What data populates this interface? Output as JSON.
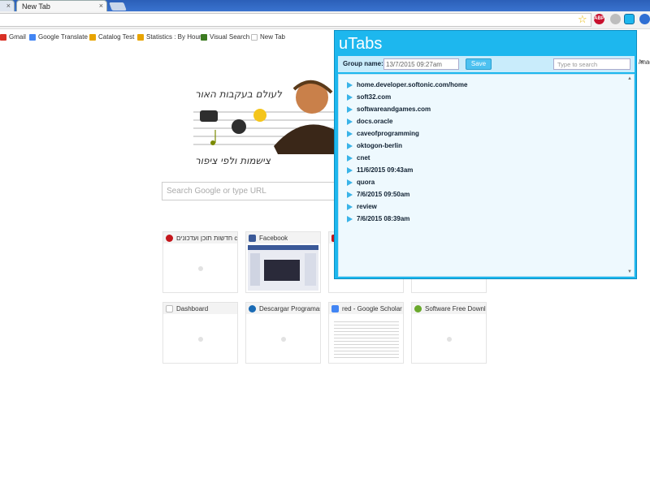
{
  "tabs": [
    {
      "label": "",
      "close": "×"
    },
    {
      "label": "New Tab",
      "close": "×"
    }
  ],
  "bookmarks": [
    {
      "label": "Gmail",
      "color": "#d93025"
    },
    {
      "label": "Google Translate",
      "color": "#4285f4"
    },
    {
      "label": "Catalog Test",
      "color": "#e8a400"
    },
    {
      "label": "Statistics : By Hour",
      "color": "#e8a400"
    },
    {
      "label": "Visual Search",
      "color": "#3b7a20"
    },
    {
      "label": "New Tab",
      "color": "#bbbbbb"
    }
  ],
  "doodle": {
    "line1": "לעולם בעקבות האור",
    "line2": "צישמות ולפי ציפור"
  },
  "search": {
    "placeholder": "Search Google or type URL"
  },
  "tiles": [
    {
      "title": "חדשות תוכן ועדכונים cnet",
      "fav": "#c4161c"
    },
    {
      "title": "Facebook",
      "fav": "#3b5998"
    },
    {
      "title": "",
      "fav": "#c4161c"
    },
    {
      "title": "",
      "fav": "#eeeeee"
    },
    {
      "title": "Dashboard",
      "fav": "#dddddd"
    },
    {
      "title": "Descargar Programas",
      "fav": "#1a6bb5"
    },
    {
      "title": "red - Google Scholar",
      "fav": "#4285f4"
    },
    {
      "title": "Software Free Download",
      "fav": "#6aa92c"
    }
  ],
  "utabs": {
    "title": "uTabs",
    "group_label": "Group name:",
    "group_value": "13/7/2015 09:27am",
    "save": "Save",
    "search_placeholder": "Type to search",
    "items": [
      "home.developer.softonic.com/home",
      "soft32.com",
      "softwareandgames.com",
      "docs.oracle",
      "caveofprogramming",
      "oktogon-berlin",
      "cnet",
      "11/6/2015 09:43am",
      "quora",
      "7/6/2015 09:50am",
      "review",
      "7/6/2015 08:39am"
    ]
  },
  "right_edge_text": "/mag"
}
